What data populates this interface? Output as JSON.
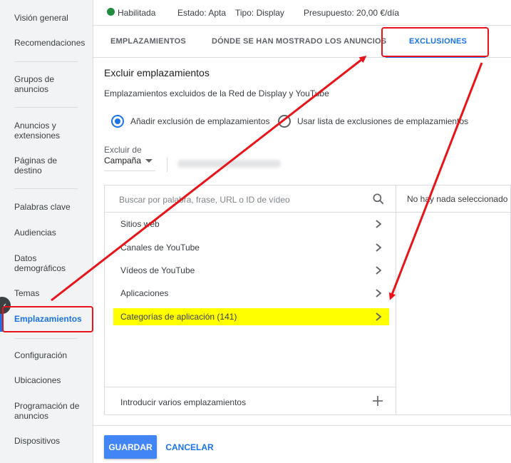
{
  "sidebar": {
    "items": [
      {
        "label": "Visión general"
      },
      {
        "label": "Recomendaciones"
      },
      {
        "label": "Grupos de anuncios"
      },
      {
        "label": "Anuncios y extensiones"
      },
      {
        "label": "Páginas de destino"
      },
      {
        "label": "Palabras clave"
      },
      {
        "label": "Audiencias"
      },
      {
        "label": "Datos demográficos"
      },
      {
        "label": "Temas"
      },
      {
        "label": "Emplazamientos"
      },
      {
        "label": "Configuración"
      },
      {
        "label": "Ubicaciones"
      },
      {
        "label": "Programación de anuncios"
      },
      {
        "label": "Dispositivos"
      }
    ],
    "active": "Emplazamientos"
  },
  "status": {
    "state": "Habilitada",
    "estado": "Estado: Apta",
    "tipo": "Tipo: Display",
    "presupuesto": "Presupuesto: 20,00 €/día"
  },
  "tabs": [
    {
      "label": "EMPLAZAMIENTOS"
    },
    {
      "label": "DÓNDE SE HAN MOSTRADO LOS ANUNCIOS"
    },
    {
      "label": "EXCLUSIONES"
    }
  ],
  "main": {
    "title": "Excluir emplazamientos",
    "subtitle": "Emplazamientos excluidos de la Red de Display y YouTube",
    "radio_add": "Añadir exclusión de emplazamientos",
    "radio_list": "Usar lista de exclusiones de emplazamientos",
    "exclude_label": "Excluir de",
    "exclude_value": "Campaña",
    "search_placeholder": "Buscar por palabra, frase, URL o ID de vídeo",
    "categories": [
      {
        "label": "Sitios web"
      },
      {
        "label": "Canales de YouTube"
      },
      {
        "label": "Vídeos de YouTube"
      },
      {
        "label": "Aplicaciones"
      },
      {
        "label": "Categorías de aplicación (141)"
      }
    ],
    "multi_entry": "Introducir varios emplazamientos",
    "selection_empty": "No hay nada seleccionado"
  },
  "footer": {
    "save": "GUARDAR",
    "cancel": "CANCELAR"
  },
  "colors": {
    "accent": "#1a73e8",
    "annotation": "#e8141a",
    "highlight": "#ffff00",
    "status_ok": "#1e8e3e"
  }
}
